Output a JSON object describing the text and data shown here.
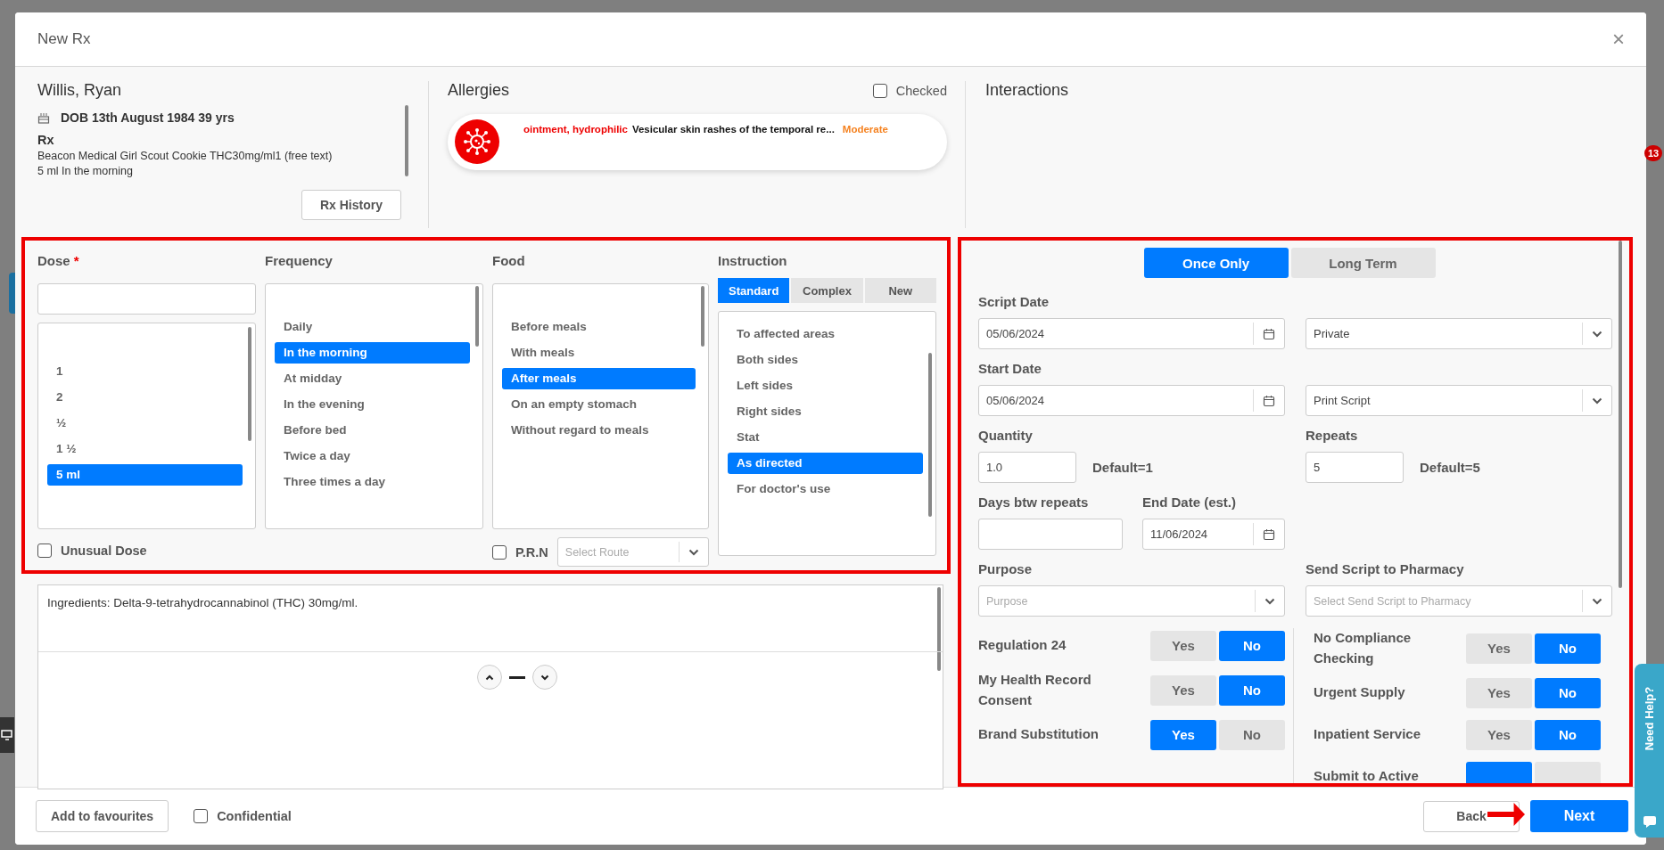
{
  "window": {
    "title": "New Rx",
    "close": "×"
  },
  "patient": {
    "name": "Willis, Ryan",
    "dob": "DOB 13th August 1984 39 yrs",
    "rx_label": "Rx",
    "rx_lines": [
      "Beacon Medical Girl Scout Cookie THC30mg/ml1 (free text)",
      "5 ml In the morning"
    ],
    "history_button": "Rx History"
  },
  "allergies": {
    "title": "Allergies",
    "checked_label": "Checked",
    "checked": false,
    "items": [
      {
        "substance": "ointment, hydrophilic",
        "reaction": "Vesicular skin rashes of the temporal re...",
        "severity": "Moderate"
      }
    ]
  },
  "interactions": {
    "title": "Interactions"
  },
  "dose": {
    "label": "Dose",
    "required_mark": "*",
    "options": [
      {
        "label": "1",
        "selected": false
      },
      {
        "label": "2",
        "selected": false
      },
      {
        "label": "½",
        "selected": false
      },
      {
        "label": "1 ½",
        "selected": false
      },
      {
        "label": "5 ml",
        "selected": true
      }
    ],
    "unusual": {
      "label": "Unusual Dose",
      "checked": false
    }
  },
  "frequency": {
    "label": "Frequency",
    "options": [
      {
        "label": "Daily",
        "selected": false
      },
      {
        "label": "In the morning",
        "selected": true
      },
      {
        "label": "At midday",
        "selected": false
      },
      {
        "label": "In the evening",
        "selected": false
      },
      {
        "label": "Before bed",
        "selected": false
      },
      {
        "label": "Twice a day",
        "selected": false
      },
      {
        "label": "Three times a day",
        "selected": false
      }
    ]
  },
  "food": {
    "label": "Food",
    "options": [
      {
        "label": "Before meals",
        "selected": false
      },
      {
        "label": "With meals",
        "selected": false
      },
      {
        "label": "After meals",
        "selected": true
      },
      {
        "label": "On an empty stomach",
        "selected": false
      },
      {
        "label": "Without regard to meals",
        "selected": false
      }
    ],
    "prn": {
      "label": "P.R.N",
      "checked": false
    },
    "route": {
      "placeholder": "Select Route"
    }
  },
  "instruction": {
    "label": "Instruction",
    "tabs": [
      {
        "label": "Standard",
        "selected": true
      },
      {
        "label": "Complex",
        "selected": false
      },
      {
        "label": "New",
        "selected": false
      }
    ],
    "options": [
      {
        "label": "To affected areas",
        "selected": false
      },
      {
        "label": "Both sides",
        "selected": false
      },
      {
        "label": "Left sides",
        "selected": false
      },
      {
        "label": "Right sides",
        "selected": false
      },
      {
        "label": "Stat",
        "selected": false
      },
      {
        "label": "As directed",
        "selected": true
      },
      {
        "label": "For doctor's use",
        "selected": false
      }
    ]
  },
  "notes": {
    "text": "Ingredients: Delta-9-tetrahydrocannabinol (THC) 30mg/ml."
  },
  "script": {
    "term_tabs": [
      {
        "label": "Once Only",
        "selected": true
      },
      {
        "label": "Long Term",
        "selected": false
      }
    ],
    "script_date": {
      "label": "Script Date",
      "value": "05/06/2024"
    },
    "script_type": {
      "value": "Private"
    },
    "start_date": {
      "label": "Start Date",
      "value": "05/06/2024"
    },
    "print_option": {
      "value": "Print Script"
    },
    "quantity": {
      "label": "Quantity",
      "value": "1.0",
      "default": "Default=1"
    },
    "repeats": {
      "label": "Repeats",
      "value": "5",
      "default": "Default=5"
    },
    "days_between": {
      "label": "Days btw repeats"
    },
    "end_date": {
      "label": "End Date (est.)",
      "value": "11/06/2024"
    },
    "purpose": {
      "label": "Purpose",
      "placeholder": "Purpose"
    },
    "pharmacy": {
      "label": "Send Script to Pharmacy",
      "placeholder": "Select Send Script to Pharmacy"
    },
    "toggles_left": [
      {
        "label": "Regulation 24",
        "options": [
          {
            "label": "Yes",
            "selected": false
          },
          {
            "label": "No",
            "selected": true
          }
        ]
      },
      {
        "label": "My Health Record Consent",
        "options": [
          {
            "label": "Yes",
            "selected": false
          },
          {
            "label": "No",
            "selected": true
          }
        ]
      },
      {
        "label": "Brand Substitution",
        "options": [
          {
            "label": "Yes",
            "selected": true
          },
          {
            "label": "No",
            "selected": false
          }
        ]
      }
    ],
    "toggles_right": [
      {
        "label": "No Compliance Checking",
        "options": [
          {
            "label": "Yes",
            "selected": false
          },
          {
            "label": "No",
            "selected": true
          }
        ]
      },
      {
        "label": "Urgent Supply",
        "options": [
          {
            "label": "Yes",
            "selected": false
          },
          {
            "label": "No",
            "selected": true
          }
        ]
      },
      {
        "label": "Inpatient Service",
        "options": [
          {
            "label": "Yes",
            "selected": false
          },
          {
            "label": "No",
            "selected": true
          }
        ]
      },
      {
        "label": "Submit to Active",
        "options": [
          {
            "selected": true
          },
          {
            "selected": false
          }
        ]
      }
    ]
  },
  "footer": {
    "favourites_button": "Add to favourites",
    "confidential": {
      "label": "Confidential",
      "checked": false
    },
    "back_button": "Back",
    "next_button": "Next"
  },
  "help_tab": {
    "label": "Need Help?"
  },
  "notification_badge": {
    "count": "13"
  }
}
